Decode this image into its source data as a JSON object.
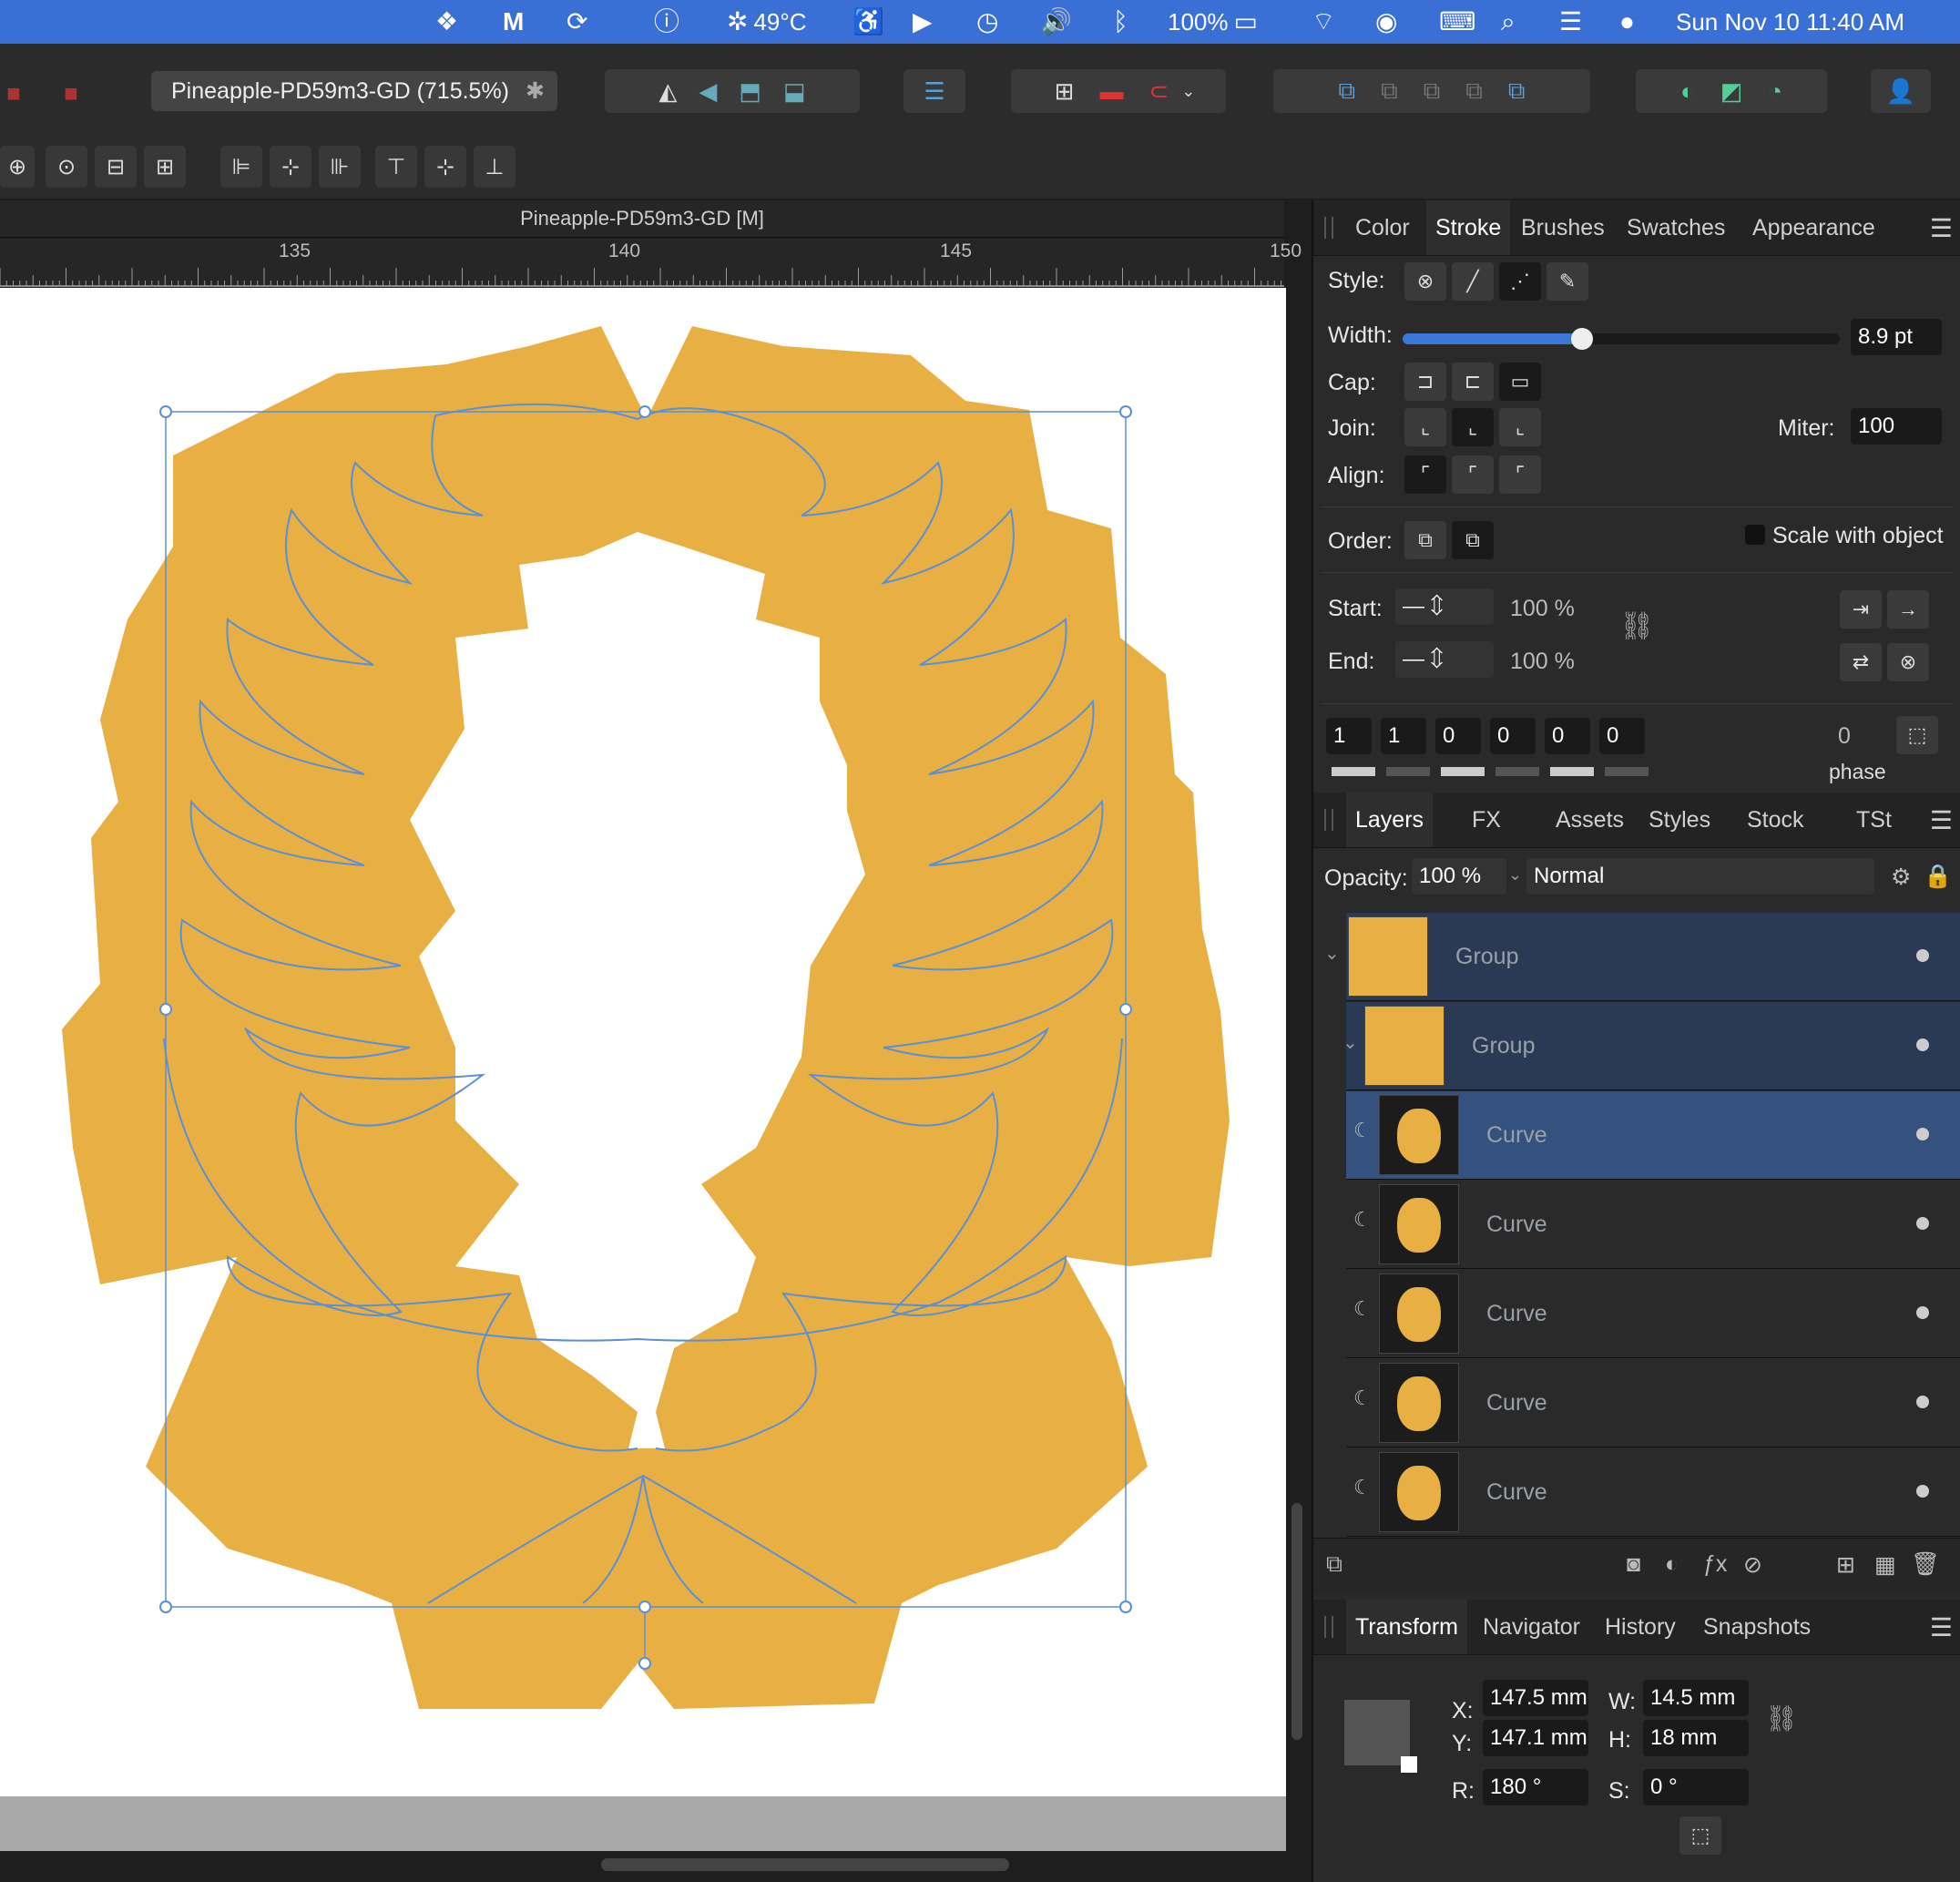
{
  "menubar": {
    "temperature": "49°C",
    "battery": "100%",
    "datetime": "Sun Nov 10  11:40 AM"
  },
  "toolbar": {
    "document_tab": "Pineapple-PD59m3-GD (715.5%)",
    "document_tab_close": "✱"
  },
  "canvas": {
    "title": "Pineapple-PD59m3-GD [M]",
    "ruler_labels": [
      "135",
      "140",
      "145",
      "150"
    ],
    "shape_color": "#e8af43",
    "path_color": "#5b8fd6"
  },
  "stroke_panel": {
    "tabs": [
      "Color",
      "Stroke",
      "Brushes",
      "Swatches",
      "Appearance"
    ],
    "active_tab": "Stroke",
    "style_label": "Style:",
    "width_label": "Width:",
    "width_value": "8.9 pt",
    "width_fraction": 0.41,
    "cap_label": "Cap:",
    "join_label": "Join:",
    "miter_label": "Miter:",
    "miter_value": "100",
    "align_label": "Align:",
    "order_label": "Order:",
    "scale_with_object": "Scale with object",
    "start_label": "Start:",
    "start_pct": "100 %",
    "end_label": "End:",
    "end_pct": "100 %",
    "dash_values": [
      "1",
      "1",
      "0",
      "0",
      "0",
      "0"
    ],
    "phase_value": "0",
    "phase_label": "phase"
  },
  "layers_panel": {
    "tabs": [
      "Layers",
      "FX",
      "Assets",
      "Styles",
      "Stock",
      "TSt"
    ],
    "active_tab": "Layers",
    "opacity_label": "Opacity:",
    "opacity_value": "100 %",
    "blend_mode": "Normal",
    "rows": [
      {
        "name": "Group",
        "indent": 0,
        "selected": true
      },
      {
        "name": "Group",
        "indent": 1,
        "selected": true
      },
      {
        "name": "Curve",
        "indent": 2,
        "selected": true
      },
      {
        "name": "Curve",
        "indent": 2,
        "selected": false
      },
      {
        "name": "Curve",
        "indent": 2,
        "selected": false
      },
      {
        "name": "Curve",
        "indent": 2,
        "selected": false
      },
      {
        "name": "Curve",
        "indent": 2,
        "selected": false
      }
    ]
  },
  "transform_panel": {
    "tabs": [
      "Transform",
      "Navigator",
      "History",
      "Snapshots"
    ],
    "active_tab": "Transform",
    "x_label": "X:",
    "x_value": "147.5 mm",
    "y_label": "Y:",
    "y_value": "147.1 mm",
    "w_label": "W:",
    "w_value": "14.5 mm",
    "h_label": "H:",
    "h_value": "18 mm",
    "r_label": "R:",
    "r_value": "180 °",
    "s_label": "S:",
    "s_value": "0 °"
  }
}
